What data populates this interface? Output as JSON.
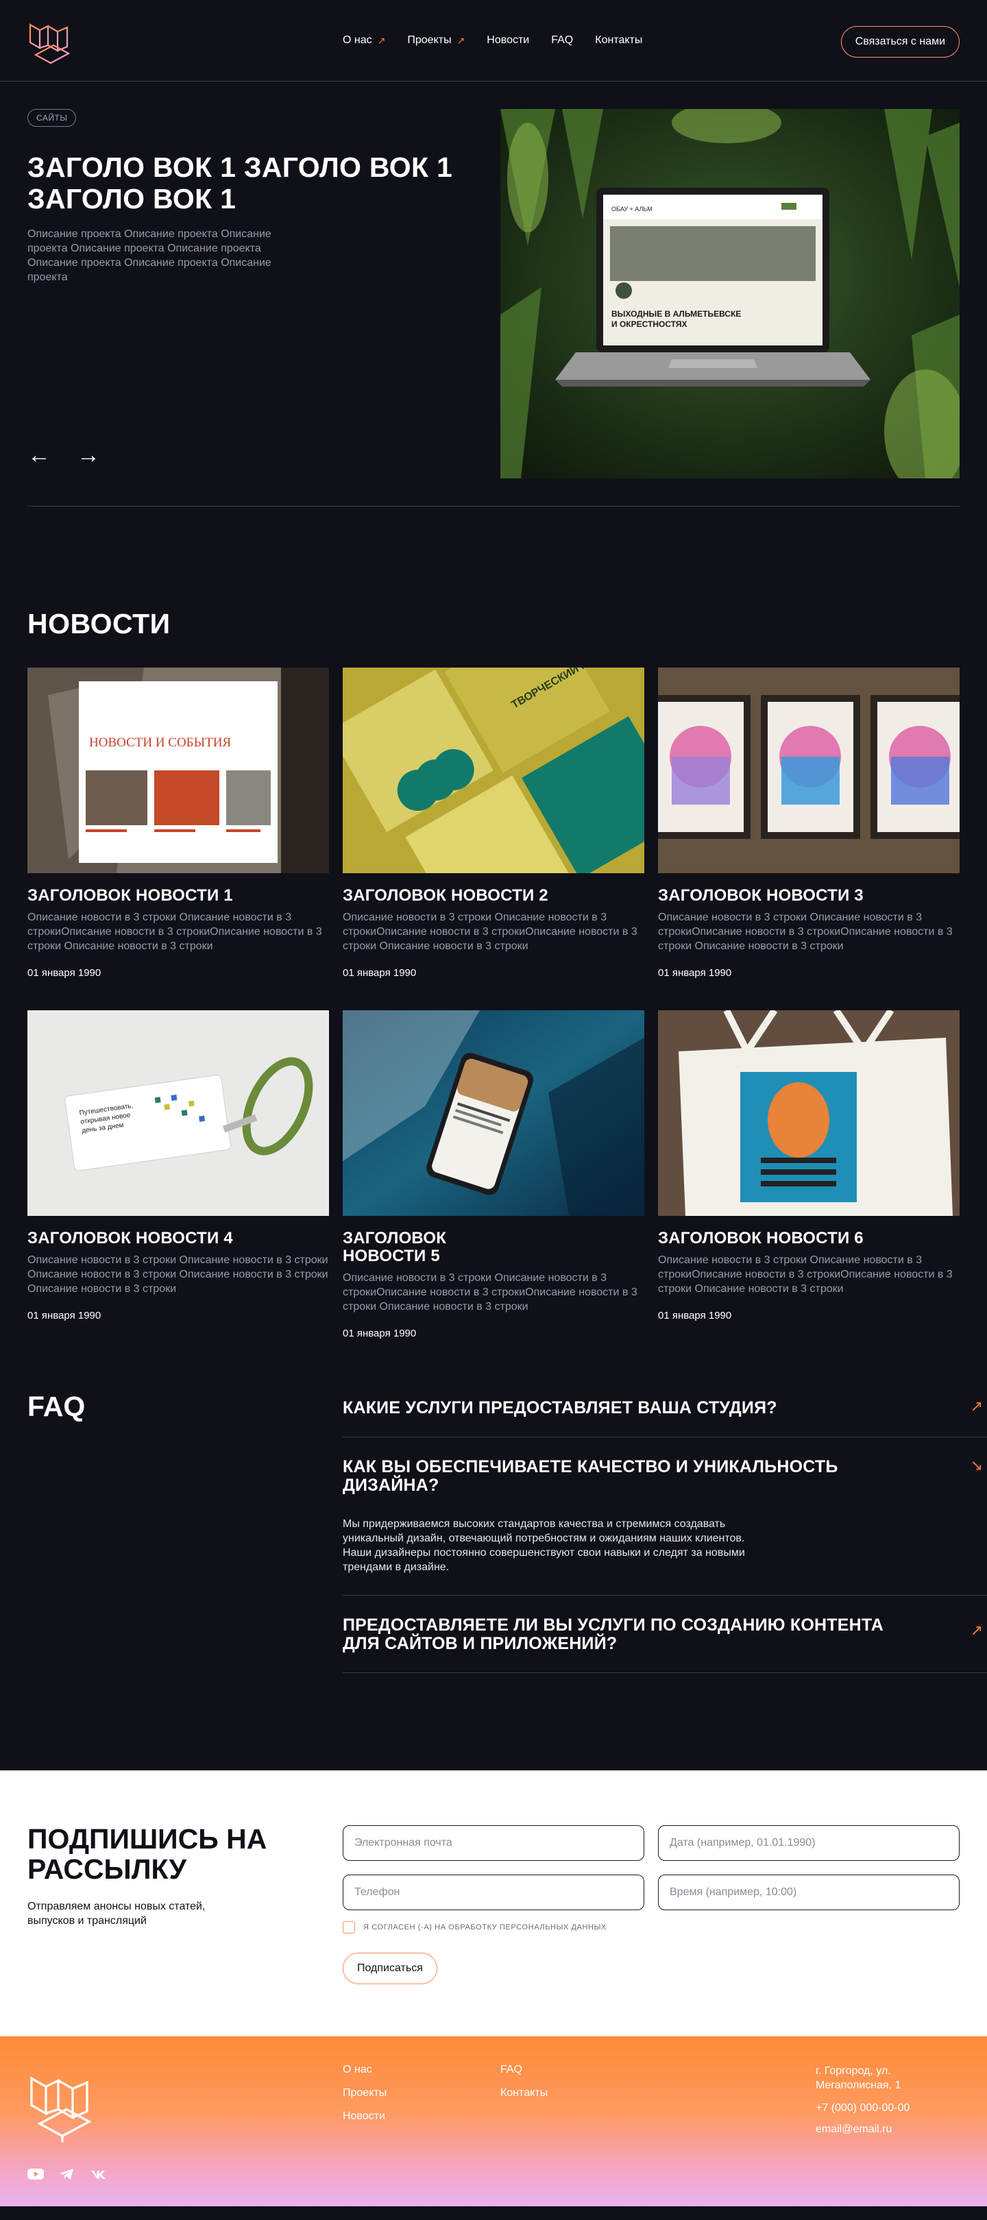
{
  "header": {
    "nav": [
      {
        "label": "О нас",
        "arrow": true
      },
      {
        "label": "Проекты",
        "arrow": true
      },
      {
        "label": "Новости",
        "arrow": false
      },
      {
        "label": "FAQ",
        "arrow": false
      },
      {
        "label": "Контакты",
        "arrow": false
      }
    ],
    "contact_button": "Связаться с нами"
  },
  "hero": {
    "tag": "САЙТЫ",
    "title": "ЗАГОЛО ВОК 1 ЗАГОЛО ВОК 1 ЗАГОЛО ВОК 1",
    "description": "Описание проекта Описание проекта Описание проекта Описание проекта Описание проекта Описание проекта Описание проекта Описание проекта",
    "laptop_screen": {
      "brand": "ОБАУ + АЛЬМ",
      "heading": "ВЫХОДНЫЕ В АЛЬМЕТЬЕВСКЕ И ОКРЕСТНОСТЯХ"
    }
  },
  "news": {
    "title": "НОВОСТИ",
    "items": [
      {
        "title": "ЗАГОЛОВОК НОВОСТИ 1",
        "desc": "Описание новости в 3 строки Описание новости в 3 строкиОписание новости в 3 строкиОписание новости в 3 строки Описание новости в 3 строки",
        "date": "01 января 1990",
        "img_text": "НОВОСТИ И СОБЫТИЯ"
      },
      {
        "title": "ЗАГОЛОВОК НОВОСТИ 2",
        "desc": "Описание новости в 3 строки Описание новости в 3 строкиОписание новости в 3 строкиОписание новости в 3 строки Описание новости в 3 строки",
        "date": "01 января 1990",
        "img_text": "ТВОРЧЕСКИЙ ПАРК"
      },
      {
        "title": "ЗАГОЛОВОК НОВОСТИ 3",
        "desc": "Описание новости в 3 строки Описание новости в 3 строкиОписание новости в 3 строкиОписание новости в 3 строки Описание новости в 3 строки",
        "date": "01 января 1990",
        "img_text": ""
      },
      {
        "title": "ЗАГОЛОВОК НОВОСТИ 4",
        "desc": "Описание новости в 3 строки Описание новости в 3 строки Описание новости в 3 строки Описание новости в 3 строки Описание новости в 3 строки",
        "date": "01 января 1990",
        "img_text": "Путешествовать, открывая новое день за днем"
      },
      {
        "title": "ЗАГОЛОВОК НОВОСТИ 5",
        "desc": "Описание новости в 3 строки Описание новости в 3 строкиОписание новости в 3 строкиОписание новости в 3 строки Описание новости в 3 строки",
        "date": "01 января 1990",
        "img_text": ""
      },
      {
        "title": "ЗАГОЛОВОК НОВОСТИ 6",
        "desc": "Описание новости в 3 строки Описание новости в 3 строкиОписание новости в 3 строкиОписание новости в 3 строки Описание новости в 3 строки",
        "date": "01 января 1990",
        "img_text": ""
      }
    ]
  },
  "faq": {
    "title": "FAQ",
    "items": [
      {
        "q": "КАКИЕ УСЛУГИ ПРЕДОСТАВЛЯЕТ ВАША СТУДИЯ?",
        "open": false,
        "a": ""
      },
      {
        "q": "КАК ВЫ ОБЕСПЕЧИВАЕТЕ КАЧЕСТВО И УНИКАЛЬНОСТЬ ДИЗАЙНА?",
        "open": true,
        "a": "Мы придерживаемся высоких стандартов качества и стремимся создавать уникальный дизайн, отвечающий потребностям и ожиданиям наших клиентов. Наши дизайнеры постоянно совершенствуют свои навыки и следят за новыми трендами в дизайне."
      },
      {
        "q": "ПРЕДОСТАВЛЯЕТЕ ЛИ ВЫ УСЛУГИ ПО СОЗДАНИЮ КОНТЕНТА ДЛЯ САЙТОВ И ПРИЛОЖЕНИЙ?",
        "open": false,
        "a": ""
      }
    ]
  },
  "subscribe": {
    "title": "ПОДПИШИСЬ НА РАССЫЛКУ",
    "desc": "Отправляем анонсы новых статей, выпусков и трансляций",
    "email_placeholder": "Электронная почта",
    "date_placeholder": "Дата (например, 01.01.1990)",
    "phone_placeholder": "Телефон",
    "time_placeholder": "Время (например, 10:00)",
    "consent": "Я СОГЛАСЕН (-А) НА ОБРАБОТКУ ПЕРСОНАЛЬНЫХ ДАННЫХ",
    "button": "Подписаться"
  },
  "footer": {
    "col1": [
      "О нас",
      "Проекты",
      "Новости"
    ],
    "col2": [
      "FAQ",
      "Контакты"
    ],
    "address": "г. Горгород, ул. Мегаполисная, 1",
    "phone": "+7 (000) 000-00-00",
    "email": "email@email.ru",
    "social": [
      "youtube-icon",
      "telegram-icon",
      "vk-icon"
    ]
  },
  "colors": {
    "accent": "#ff7a3d",
    "background": "#101019",
    "muted_text": "#9a9aaa"
  }
}
